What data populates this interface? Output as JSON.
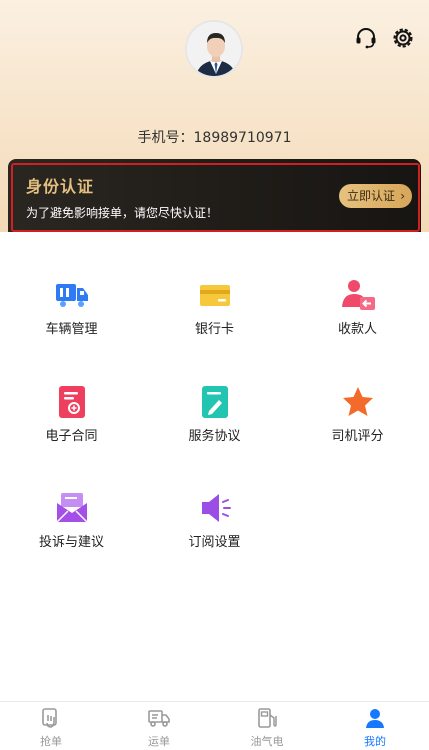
{
  "profile": {
    "phone_label": "手机号：",
    "phone_number": "18989710971"
  },
  "header_icons": [
    "headset-icon",
    "gear-icon"
  ],
  "verify": {
    "title": "身份认证",
    "description": "为了避免影响接单，请您尽快认证！",
    "button_label": "立即认证",
    "accent_color": "#e5bf7f"
  },
  "menu": {
    "items": [
      {
        "label": "车辆管理",
        "icon": "truck-icon"
      },
      {
        "label": "银行卡",
        "icon": "bank-card-icon"
      },
      {
        "label": "收款人",
        "icon": "payee-icon"
      },
      {
        "label": "电子合同",
        "icon": "contract-icon"
      },
      {
        "label": "服务协议",
        "icon": "agreement-icon"
      },
      {
        "label": "司机评分",
        "icon": "star-icon"
      },
      {
        "label": "投诉与建议",
        "icon": "envelope-icon"
      },
      {
        "label": "订阅设置",
        "icon": "speaker-icon"
      }
    ]
  },
  "tabbar": {
    "items": [
      {
        "label": "抢单",
        "icon": "grab-order-icon"
      },
      {
        "label": "运单",
        "icon": "truck-icon"
      },
      {
        "label": "油气电",
        "icon": "fuel-icon"
      },
      {
        "label": "我的",
        "icon": "person-icon"
      }
    ],
    "active_index": 3,
    "active_color": "#1677ff"
  }
}
